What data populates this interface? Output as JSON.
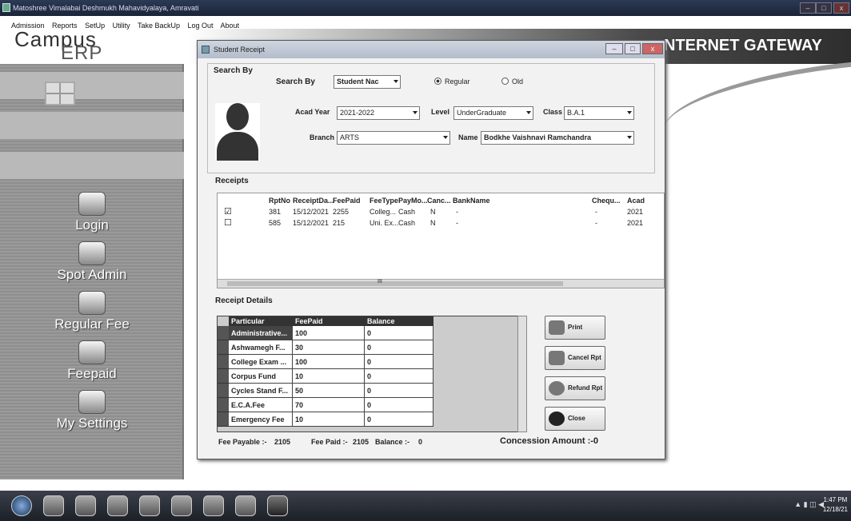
{
  "window": {
    "title": "Matoshree Vimalabai Deshmukh Mahavidyalaya, Amravati",
    "minimize": "–",
    "maximize": "□",
    "close": "x"
  },
  "menu": [
    "Admission",
    "Reports",
    "SetUp",
    "Utility",
    "Take BackUp",
    "Log Out",
    "About"
  ],
  "brand": {
    "line1": "Campus",
    "line2": "ERP"
  },
  "gateway": "NTERNET GATEWAY",
  "nav": [
    {
      "label": "Login",
      "icon": "key-icon"
    },
    {
      "label": "Spot Admin",
      "icon": "user-card-icon"
    },
    {
      "label": "Regular Fee",
      "icon": "document-icon"
    },
    {
      "label": "Feepaid",
      "icon": "users-icon"
    },
    {
      "label": "My Settings",
      "icon": "wrench-icon"
    }
  ],
  "dialog": {
    "title": "Student Receipt",
    "search": {
      "group_label": "Search By",
      "search_by_label": "Search By",
      "search_by_value": "Student Nac",
      "radio_regular": "Regular",
      "radio_old": "Old",
      "acad_year_label": "Acad Year",
      "acad_year": "2021-2022",
      "level_label": "Level",
      "level": "UnderGraduate",
      "class_label": "Class",
      "class": "B.A.1",
      "branch_label": "Branch",
      "branch": "ARTS",
      "name_label": "Name",
      "name": "Bodkhe Vaishnavi Ramchandra"
    },
    "receipts": {
      "label": "Receipts",
      "headers": [
        "RptNo",
        "ReceiptDa...",
        "FeePaid",
        "FeeType",
        "PayMo...",
        "Canc...",
        "BankName",
        "Chequ...",
        "Acad"
      ],
      "rows": [
        {
          "checked": "☑",
          "cells": [
            "381",
            "15/12/2021",
            "2255",
            "Colleg...",
            "Cash",
            "N",
            "-",
            "-",
            "2021"
          ]
        },
        {
          "checked": "☐",
          "cells": [
            "585",
            "15/12/2021",
            "215",
            "Uni. Ex...",
            "Cash",
            "N",
            "-",
            "-",
            "2021"
          ]
        }
      ],
      "scroll_marker": "III"
    },
    "details": {
      "label": "Receipt Details",
      "headers": [
        "Particular",
        "FeePaid",
        "Balance"
      ],
      "rows": [
        [
          "Administrative...",
          "100",
          "0"
        ],
        [
          "Ashwamegh F...",
          "30",
          "0"
        ],
        [
          "College Exam ...",
          "100",
          "0"
        ],
        [
          "Corpus Fund",
          "10",
          "0"
        ],
        [
          "Cycles Stand F...",
          "50",
          "0"
        ],
        [
          "E.C.A.Fee",
          "70",
          "0"
        ],
        [
          "Emergency Fee",
          "10",
          "0"
        ]
      ]
    },
    "buttons": {
      "print": "Print",
      "cancel": "Cancel Rpt",
      "refund": "Refund Rpt",
      "close": "Close"
    },
    "footer": {
      "payable_label": "Fee Payable :-",
      "payable": "2105",
      "paid_label": "Fee Paid :-",
      "paid": "2105",
      "balance_label": "Balance :-",
      "balance": "0",
      "concession": "Concession Amount :-0"
    }
  },
  "taskbar": {
    "tray": "▲ ▮ ◫ ◀",
    "time": "1:47 PM",
    "date": "12/18/21"
  }
}
